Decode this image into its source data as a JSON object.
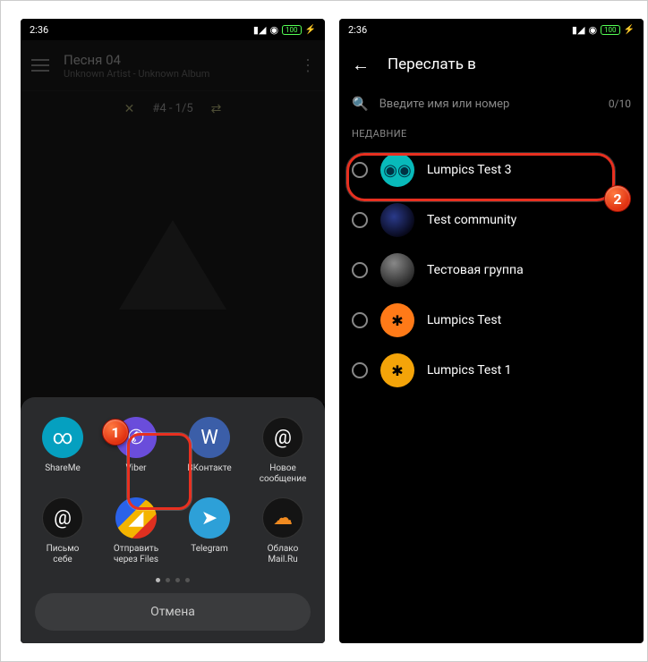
{
  "status": {
    "time": "2:36",
    "battery": "100"
  },
  "player": {
    "title": "Песня 04",
    "subtitle": "Unknown Artist - Unknown Album",
    "trackinfo": "#4  -  1/5"
  },
  "share": {
    "items": [
      {
        "label": "ShareMe",
        "icon": "shareme"
      },
      {
        "label": "Viber",
        "icon": "viber"
      },
      {
        "label": "ВКонтакте",
        "icon": "vk"
      },
      {
        "label": "Новое\nсообщение",
        "icon": "mail"
      },
      {
        "label": "Письмо\nсебе",
        "icon": "mail2"
      },
      {
        "label": "Отправить\nчерез Files",
        "icon": "files"
      },
      {
        "label": "Telegram",
        "icon": "telegram"
      },
      {
        "label": "Облако\nMail.Ru",
        "icon": "cloud"
      }
    ],
    "cancel": "Отмена"
  },
  "viber": {
    "header": "Переслать в",
    "search_placeholder": "Введите имя или номер",
    "counter": "0/10",
    "section": "НЕДАВНИЕ",
    "contacts": [
      {
        "name": "Lumpics Test 3",
        "avatar": "cyan"
      },
      {
        "name": "Test community",
        "avatar": "galaxy"
      },
      {
        "name": "Тестовая группа",
        "avatar": "globe"
      },
      {
        "name": "Lumpics Test",
        "avatar": "orange"
      },
      {
        "name": "Lumpics Test 1",
        "avatar": "lemon"
      }
    ]
  },
  "badges": {
    "one": "1",
    "two": "2"
  }
}
